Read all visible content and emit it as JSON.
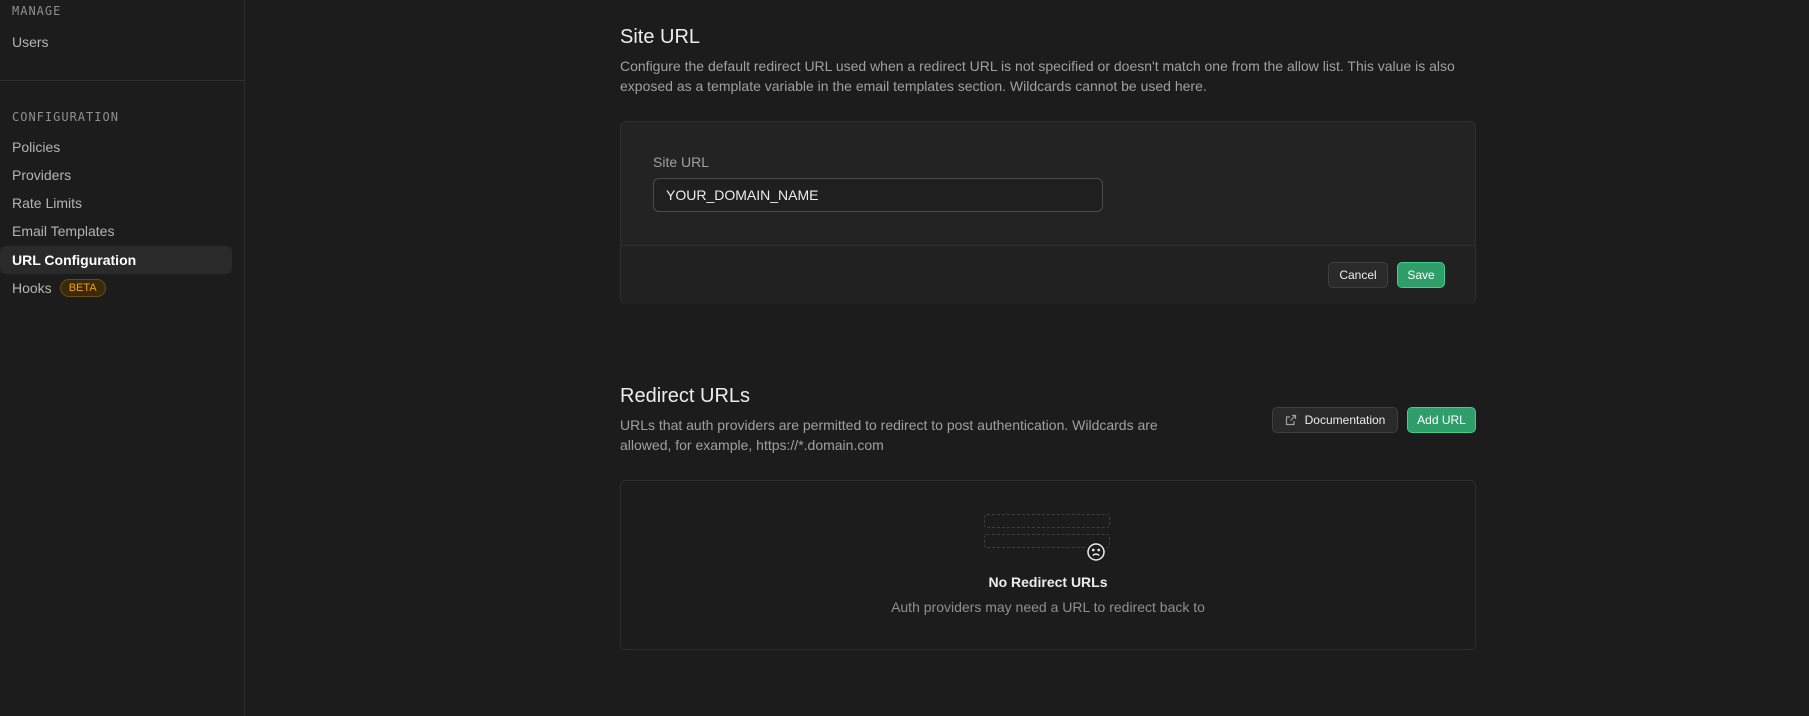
{
  "sidebar": {
    "manage_title": "MANAGE",
    "manage_items": [
      {
        "label": "Users"
      }
    ],
    "config_title": "CONFIGURATION",
    "config_items": [
      {
        "label": "Policies"
      },
      {
        "label": "Providers"
      },
      {
        "label": "Rate Limits"
      },
      {
        "label": "Email Templates"
      },
      {
        "label": "URL Configuration",
        "active": true
      },
      {
        "label": "Hooks",
        "badge": "BETA"
      }
    ]
  },
  "site_url": {
    "title": "Site URL",
    "description": "Configure the default redirect URL used when a redirect URL is not specified or doesn't match one from the allow list. This value is also exposed as a template variable in the email templates section. Wildcards cannot be used here.",
    "field_label": "Site URL",
    "field_value": "YOUR_DOMAIN_NAME",
    "cancel_label": "Cancel",
    "save_label": "Save"
  },
  "redirect_urls": {
    "title": "Redirect URLs",
    "description": "URLs that auth providers are permitted to redirect to post authentication. Wildcards are allowed, for example, https://*.domain.com",
    "documentation_label": "Documentation",
    "add_url_label": "Add URL",
    "empty_title": "No Redirect URLs",
    "empty_subtitle": "Auth providers may need a URL to redirect back to"
  },
  "colors": {
    "background": "#1c1c1c",
    "accent": "#3fcf8e",
    "badge": "#f1a10d"
  },
  "icons": {
    "documentation": "external-link-icon",
    "empty_state": "sad-face-icon"
  }
}
